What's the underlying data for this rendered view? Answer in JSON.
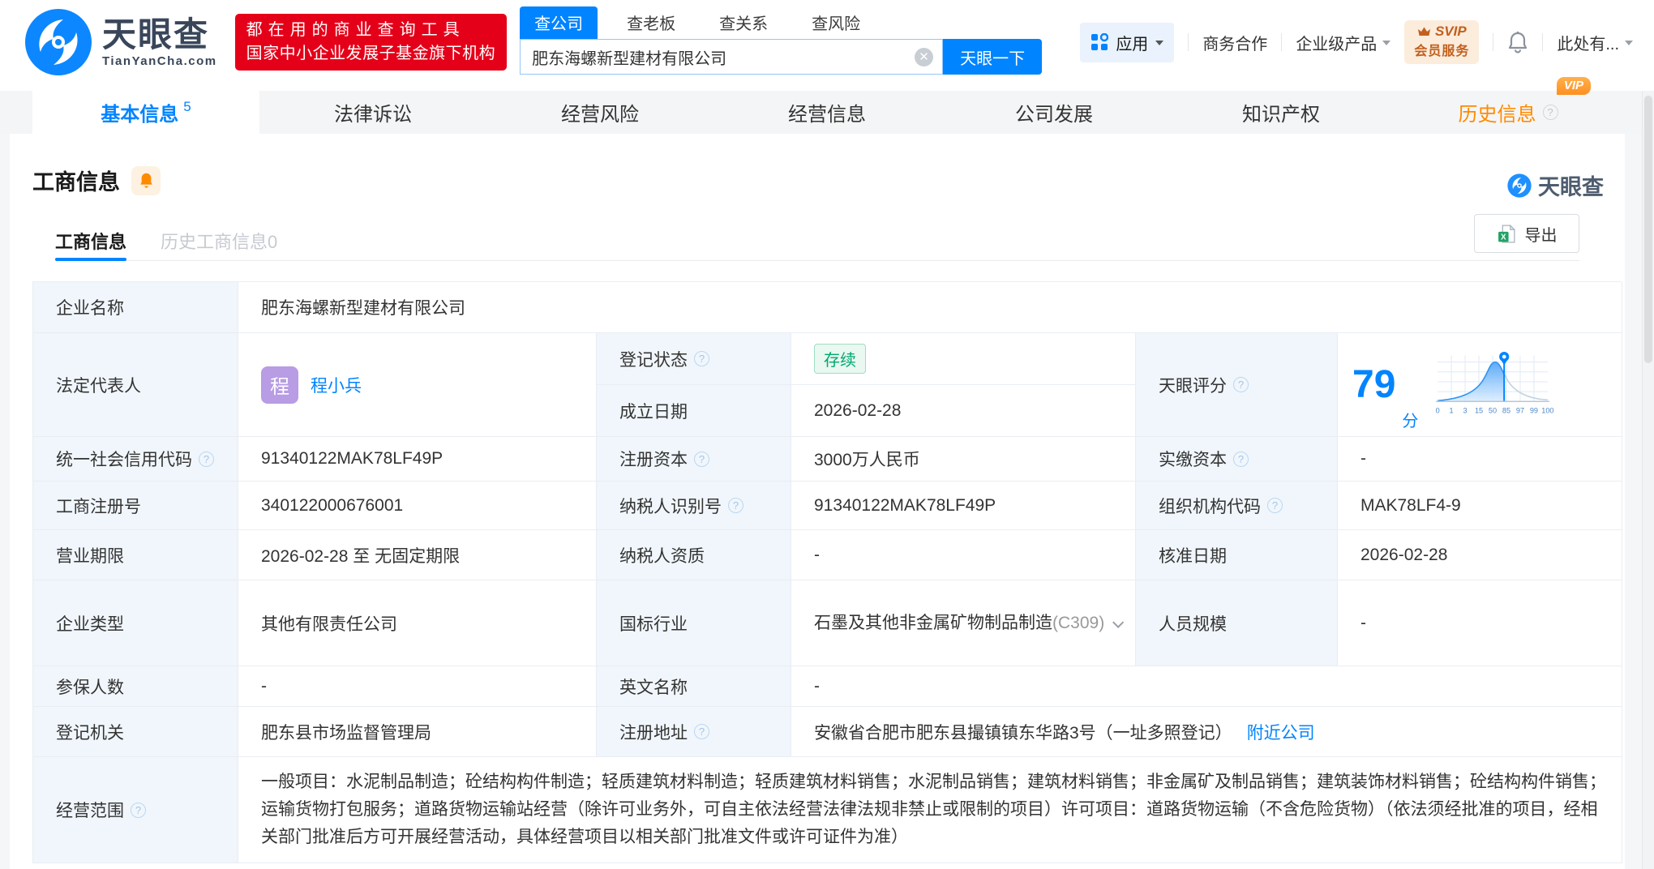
{
  "header": {
    "logo_title": "天眼查",
    "logo_domain": "TianYanCha.com",
    "promo_line1": "都在用的商业查询工具",
    "promo_line2": "国家中小企业发展子基金旗下机构",
    "search_tabs": [
      {
        "label": "查公司"
      },
      {
        "label": "查老板"
      },
      {
        "label": "查关系"
      },
      {
        "label": "查风险"
      }
    ],
    "search_value": "肥东海螺新型建材有限公司",
    "search_button": "天眼一下",
    "nav": {
      "apps": "应用",
      "biz": "商务合作",
      "enterprise": "企业级产品",
      "svip_top": "SVIP",
      "svip_bottom": "会员服务",
      "more": "此处有..."
    }
  },
  "tabs": [
    {
      "label": "基本信息",
      "count": "5"
    },
    {
      "label": "法律诉讼"
    },
    {
      "label": "经营风险"
    },
    {
      "label": "经营信息"
    },
    {
      "label": "公司发展"
    },
    {
      "label": "知识产权"
    },
    {
      "label": "历史信息",
      "vip": "VIP"
    }
  ],
  "section": {
    "title": "工商信息",
    "subtab_active": "工商信息",
    "subtab_history": "历史工商信息0",
    "export_label": "导出",
    "watermark": "天眼查"
  },
  "fields": {
    "company_name": {
      "label": "企业名称",
      "value": "肥东海螺新型建材有限公司"
    },
    "legal_rep": {
      "label": "法定代表人",
      "value": "程小兵",
      "avatar": "程"
    },
    "reg_status": {
      "label": "登记状态",
      "value": "存续"
    },
    "est_date": {
      "label": "成立日期",
      "value": "2026-02-28"
    },
    "score": {
      "label": "天眼评分",
      "value": "79",
      "unit": "分",
      "ticks": [
        "0",
        "1",
        "3",
        "15",
        "50",
        "85",
        "97",
        "99",
        "100"
      ]
    },
    "credit_code": {
      "label": "统一社会信用代码",
      "value": "91340122MAK78LF49P"
    },
    "reg_capital": {
      "label": "注册资本",
      "value": "3000万人民币"
    },
    "paid_capital": {
      "label": "实缴资本",
      "value": "-"
    },
    "reg_number": {
      "label": "工商注册号",
      "value": "340122000676001"
    },
    "taxpayer_id": {
      "label": "纳税人识别号",
      "value": "91340122MAK78LF49P"
    },
    "org_code": {
      "label": "组织机构代码",
      "value": "MAK78LF4-9"
    },
    "business_term": {
      "label": "营业期限",
      "value": "2026-02-28 至 无固定期限"
    },
    "taxpayer_qualification": {
      "label": "纳税人资质",
      "value": "-"
    },
    "approval_date": {
      "label": "核准日期",
      "value": "2026-02-28"
    },
    "company_type": {
      "label": "企业类型",
      "value": "其他有限责任公司"
    },
    "industry": {
      "label": "国标行业",
      "value": "石墨及其他非金属矿物制品制造",
      "code": "(C309)"
    },
    "staff_size": {
      "label": "人员规模",
      "value": "-"
    },
    "insured_count": {
      "label": "参保人数",
      "value": "-"
    },
    "english_name": {
      "label": "英文名称",
      "value": "-"
    },
    "reg_authority": {
      "label": "登记机关",
      "value": "肥东县市场监督管理局"
    },
    "reg_address": {
      "label": "注册地址",
      "value": "安徽省合肥市肥东县撮镇镇东华路3号（一址多照登记）",
      "nearby_link": "附近公司"
    },
    "business_scope": {
      "label": "经营范围",
      "value": "一般项目：水泥制品制造；砼结构构件制造；轻质建筑材料制造；轻质建筑材料销售；水泥制品销售；建筑材料销售；非金属矿及制品销售；建筑装饰材料销售；砼结构构件销售；运输货物打包服务；道路货物运输站经营（除许可业务外，可自主依法经营法律法规非禁止或限制的项目）许可项目：道路货物运输（不含危险货物）（依法须经批准的项目，经相关部门批准后方可开展经营活动，具体经营项目以相关部门批准文件或许可证件为准）"
    }
  },
  "colors": {
    "brand_blue": "#0084ff",
    "promo_red": "#e50019",
    "status_green": "#00a870",
    "vip_orange": "#ff8a00",
    "label_bg": "#f0f6fb"
  }
}
